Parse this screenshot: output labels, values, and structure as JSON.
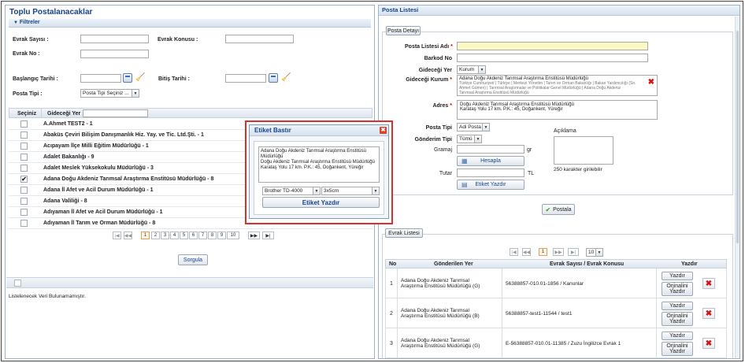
{
  "left": {
    "title": "Toplu Postalanacaklar",
    "filters_label": "Filtreler",
    "evrak_sayisi_label": "Evrak Sayısı :",
    "evrak_konusu_label": "Evrak Konusu :",
    "evrak_no_label": "Evrak No :",
    "baslangic_label": "Başlangıç Tarihi :",
    "bitis_label": "Bitiş Tarihi :",
    "posta_tipi_label": "Posta Tipi :",
    "posta_tipi_value": "Posta Tipi Seçiniz ...",
    "col_seciniz": "Seçiniz",
    "col_gidecegi": "Gideceği Yer",
    "rows": [
      "A.Ahmet TEST2 - 1",
      "Abaküs Çeviri Bilişim Danışmanlık Hiz. Yay. ve Tic. Ltd.Şti. - 1",
      "Acıpayam İlçe Milli Eğitim Müdürlüğü - 1",
      "Adalet Bakanlığı - 9",
      "Adalet Meslek Yüksekokulu Müdürlüğü - 3",
      "Adana Doğu Akdeniz Tarımsal Araştırma Enstitüsü Müdürlüğü - 8",
      "Adana İl Afet ve Acil Durum Müdürlüğü - 1",
      "Adana Valiliği - 8",
      "Adıyaman İl Afet ve Acil Durum Müdürlüğü - 1",
      "Adıyaman İl Tarım ve Orman Müdürlüğü - 8"
    ],
    "checked_row_index": 5,
    "pages": [
      "1",
      "2",
      "3",
      "4",
      "5",
      "6",
      "7",
      "8",
      "9",
      "10"
    ],
    "first_label": "|◀",
    "prev_label": "◀◀",
    "next_label": "▶▶",
    "last_label": "▶|",
    "sorgula_label": "Sorgula",
    "empty_text": "Listelenecek Veri Bulunamamıştır."
  },
  "modal": {
    "title": "Etiket Bastır",
    "address_text": "Adana Doğu Akdeniz Tarımsal Araştırma Enstitüsü Müdürlüğü\nDoğu Akdeniz Tarımsal Araştırma Enstitüsü Müdürlüğü\nKarataş Yolu 17 km. P.K.: 45, Doğankent, Yüreğir",
    "printer": "Brother TD-4000",
    "size": "3x5cm",
    "print_label": "Etiket Yazdır"
  },
  "right": {
    "title": "Posta Listesi",
    "detail_legend": "Posta Detayı",
    "posta_listesi_adi_label": "Posta Listesi Adı",
    "barkod_no_label": "Barkod No",
    "gidecegi_yer_label": "Gideceği Yer",
    "gidecegi_yer_value": "Kurum",
    "gidecegi_kurum_label": "Gideceği Kurum",
    "kurum_name": "Adana Doğu Akdeniz Tarımsal Araştırma Enstitüsü Müdürlüğü",
    "kurum_path": "Türkiye Cumhuriyeti | Türkiye | Merkezi Yönetim | Tarım ve Orman Bakanlığı | Bakan Yardımcılığı (Sn. Ahmet Gümen) | Tarımsal Araştırmalar ve Politikalar Genel Müdürlüğü | Adana Doğu Akdeniz Tarımsal Araştırma Enstitüsü Müdürlüğü",
    "adres_label": "Adres",
    "adres_text": "Doğu Akdeniz Tarımsal Araştırma Enstitüsü Müdürlüğü\nKarataş Yolu 17 km. P.K.: 45, Doğankent, Yüreğir",
    "posta_tipi_label": "Posta Tipi",
    "posta_tipi_value": "Adi Posta",
    "gonderim_tipi_label": "Gönderim Tipi",
    "gonderim_tipi_value": "Tümü",
    "gramaj_label": "Gramaj",
    "gr_unit": "gr",
    "hesapla_label": "Hesapla",
    "tutar_label": "Tutar",
    "tl_unit": "TL",
    "etiket_label": "Etiket Yazdır",
    "aciklama_label": "Açıklama",
    "chars_hint": "250 karakter girilebilir",
    "postala_label": "Postala",
    "evrak_legend": "Evrak Listesi",
    "current_page": "1",
    "page_size": "10",
    "col_no": "No",
    "col_gonderilen": "Gönderilen Yer",
    "col_evrak": "Evrak Sayısı / Evrak Konusu",
    "col_yazdir": "Yazdır",
    "yazdir_label": "Yazdır",
    "orijinalini_label": "Orjinalini Yazdır",
    "evrak_rows": [
      {
        "no": "1",
        "place": "Adana Doğu Akdeniz Tarımsal Araştırma Enstitüsü Müdürlüğü (G)",
        "evrak": "56388857-010.01-1856 / Kanunlar"
      },
      {
        "no": "2",
        "place": "Adana Doğu Akdeniz Tarımsal Araştırma Enstitüsü Müdürlüğü (B)",
        "evrak": "56388857-test1-11544 / test1"
      },
      {
        "no": "3",
        "place": "Adana Doğu Akdeniz Tarımsal Araştırma Enstitüsü Müdürlüğü (G)",
        "evrak": "E-56388857-010.01-11385 / Zuzu İngilizce Evrak 1"
      }
    ]
  },
  "colors": {
    "title_blue": "#15428b",
    "highlight": "#d6322d",
    "input_yellow": "#fbf8c4"
  }
}
